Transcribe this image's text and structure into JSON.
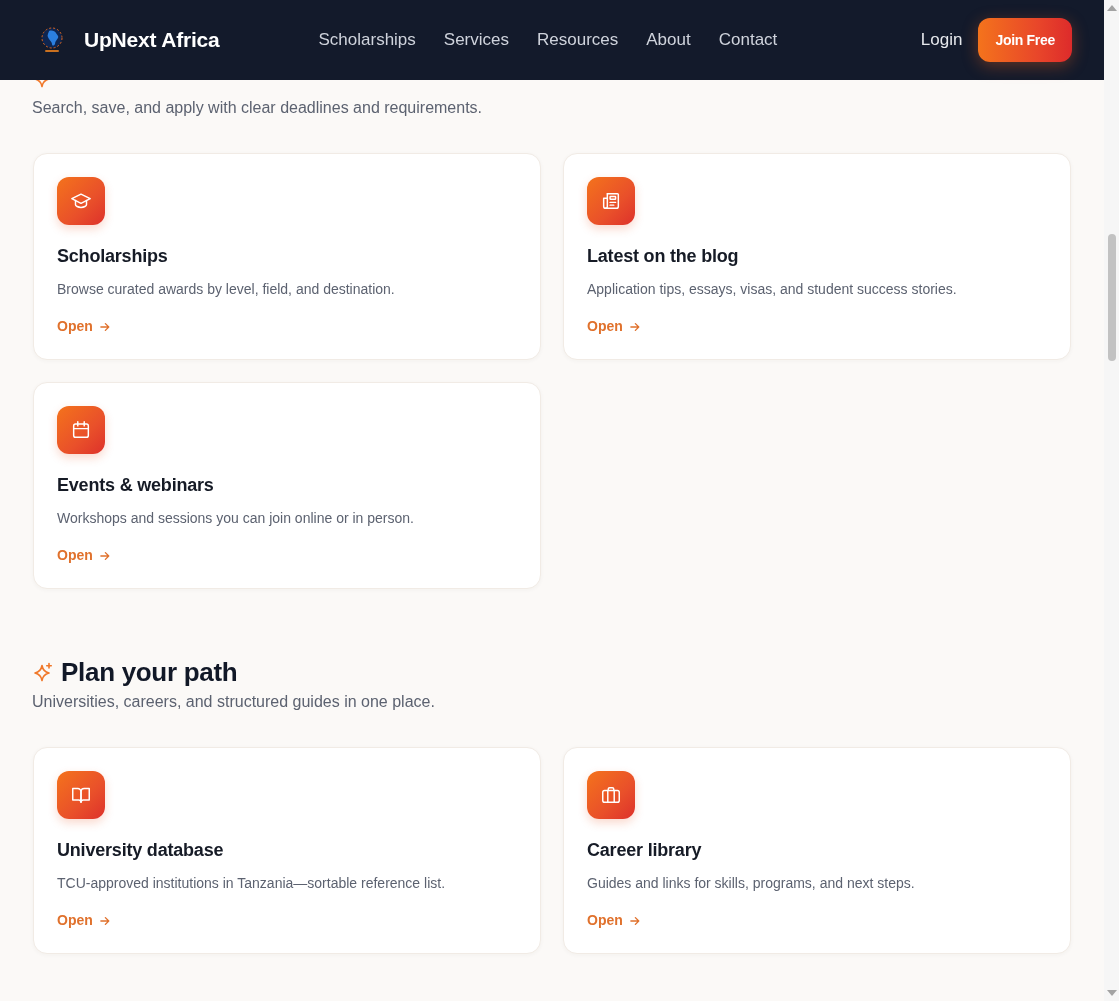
{
  "header": {
    "brand": "UpNext Africa",
    "nav": [
      "Scholarships",
      "Services",
      "Resources",
      "About",
      "Contact"
    ],
    "login": "Login",
    "cta": "Join Free"
  },
  "sections": [
    {
      "subtitle": "Search, save, and apply with clear deadlines and requirements.",
      "cards": [
        {
          "title": "Scholarships",
          "description": "Browse curated awards by level, field, and destination.",
          "link": "Open"
        },
        {
          "title": "Latest on the blog",
          "description": "Application tips, essays, visas, and student success stories.",
          "link": "Open"
        },
        {
          "title": "Events & webinars",
          "description": "Workshops and sessions you can join online or in person.",
          "link": "Open"
        }
      ]
    },
    {
      "title": "Plan your path",
      "subtitle": "Universities, careers, and structured guides in one place.",
      "cards": [
        {
          "title": "University database",
          "description": "TCU-approved institutions in Tanzania—sortable reference list.",
          "link": "Open"
        },
        {
          "title": "Career library",
          "description": "Guides and links for skills, programs, and next steps.",
          "link": "Open"
        }
      ]
    }
  ]
}
